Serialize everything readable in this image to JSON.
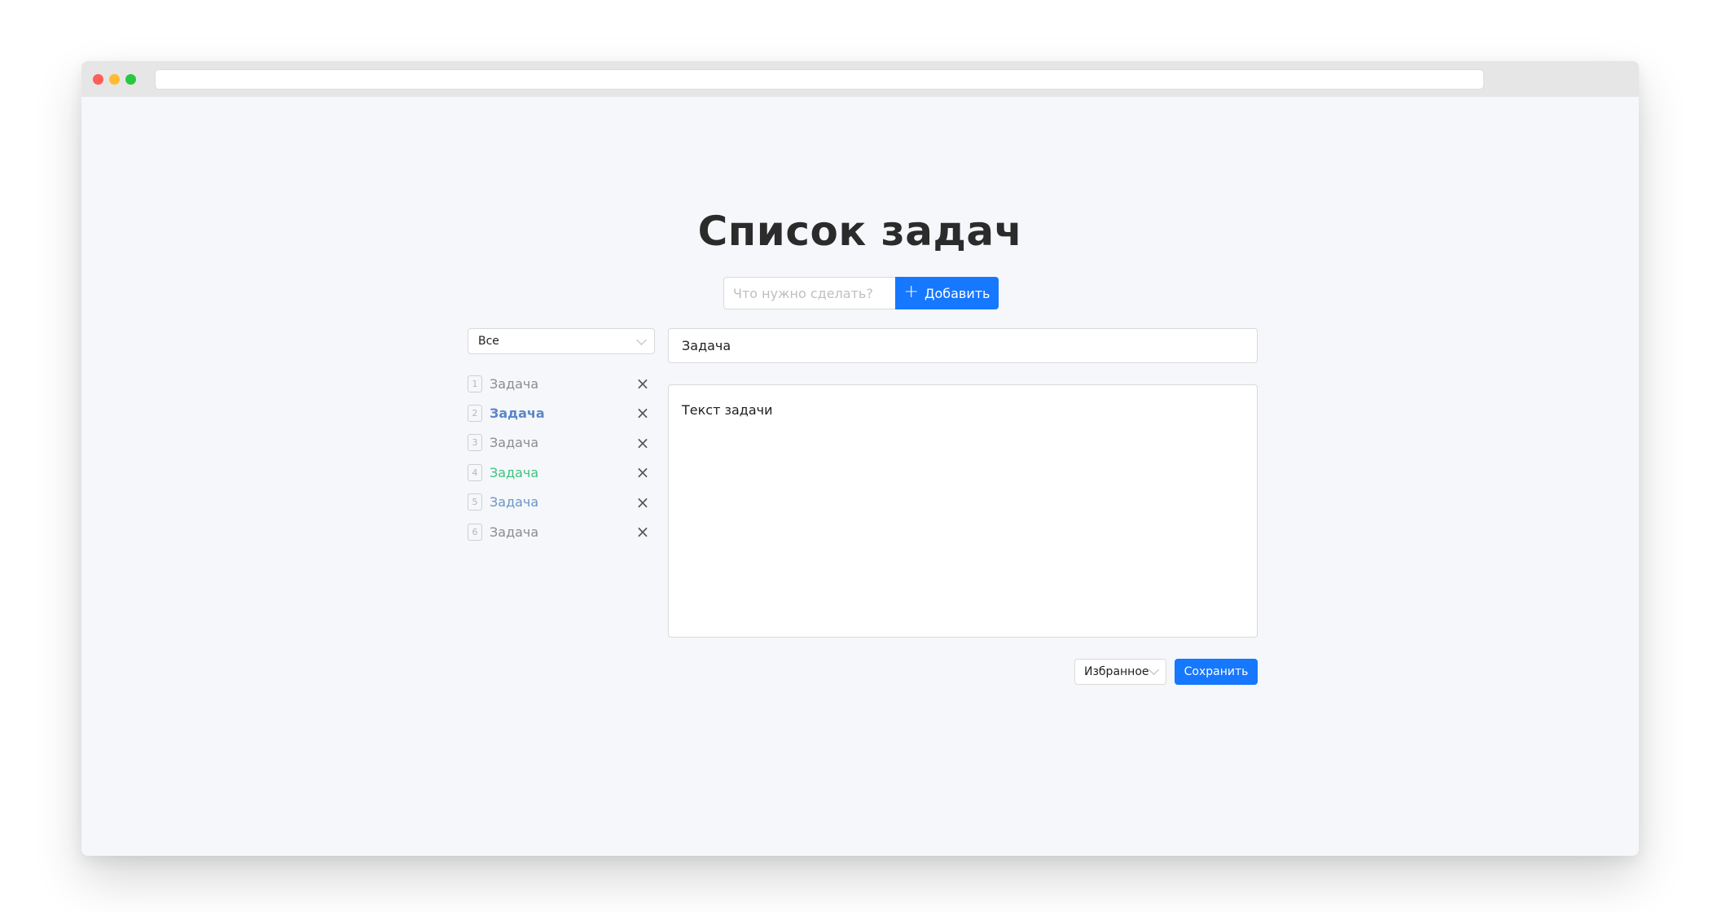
{
  "page": {
    "title": "Список задач"
  },
  "new_task": {
    "placeholder": "Что нужно сделать?",
    "add_label": "Добавить"
  },
  "filter": {
    "selected": "Все"
  },
  "tasks": [
    {
      "number": "1",
      "label": "Задача",
      "color": "#8c8c8c",
      "bold": false
    },
    {
      "number": "2",
      "label": "Задача",
      "color": "#5b87c7",
      "bold": true
    },
    {
      "number": "3",
      "label": "Задача",
      "color": "#8c8c8c",
      "bold": false
    },
    {
      "number": "4",
      "label": "Задача",
      "color": "#3cc47c",
      "bold": false
    },
    {
      "number": "5",
      "label": "Задача",
      "color": "#6d94c8",
      "bold": false
    },
    {
      "number": "6",
      "label": "Задача",
      "color": "#8c8c8c",
      "bold": false
    }
  ],
  "editor": {
    "title_value": "Задача",
    "text_value": "Текст задачи"
  },
  "footer": {
    "category_selected": "Избранное",
    "save_label": "Сохранить"
  },
  "colors": {
    "accent": "#1677ff",
    "background": "#f5f7fa"
  }
}
